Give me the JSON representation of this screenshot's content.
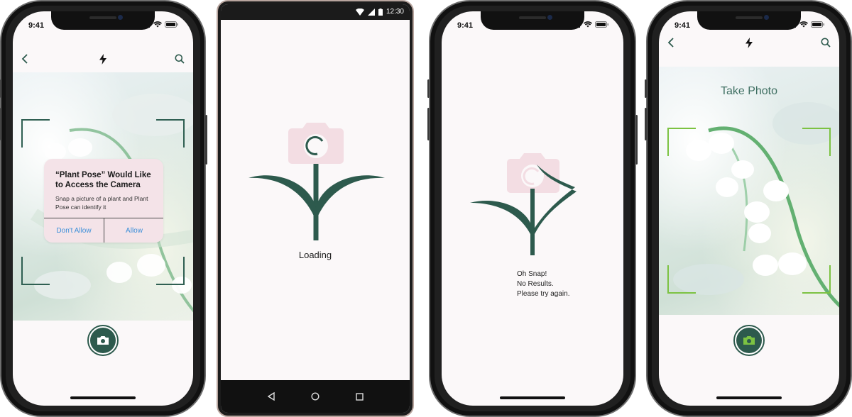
{
  "screen1": {
    "status_time": "9:41",
    "dialog": {
      "title": "“Plant Pose” Would Like to Access the Camera",
      "message": "Snap a picture of a plant and Plant Pose can identify it",
      "deny_label": "Don't Allow",
      "allow_label": "Allow"
    }
  },
  "screen2": {
    "status_time": "12:30",
    "loading_label": "Loading"
  },
  "screen3": {
    "status_time": "9:41",
    "error_line1": "Oh Snap!",
    "error_line2": "No Results.",
    "error_line3": "Please try again."
  },
  "screen4": {
    "status_time": "9:41",
    "title": "Take Photo"
  },
  "colors": {
    "brand_green": "#2d5a4d",
    "accent_green": "#7cc242",
    "camera_pink": "#f3dde3",
    "link_blue": "#3b8fd9"
  },
  "icons": [
    "back-icon",
    "flash-icon",
    "search-icon",
    "camera-icon",
    "signal-icon",
    "wifi-icon",
    "battery-icon"
  ]
}
